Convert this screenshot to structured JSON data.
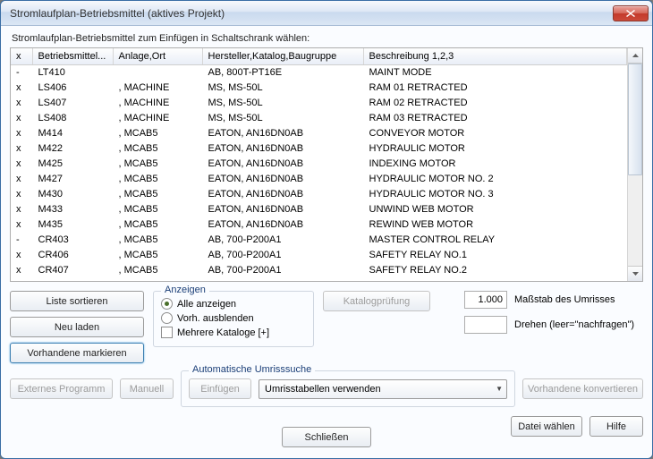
{
  "window": {
    "title": "Stromlaufplan-Betriebsmittel (aktives Projekt)"
  },
  "instruction": "Stromlaufplan-Betriebsmittel zum Einfügen in Schaltschrank wählen:",
  "table": {
    "headers": {
      "x": "x",
      "bm": "Betriebsmittel...",
      "ort": "Anlage,Ort",
      "hkb": "Hersteller,Katalog,Baugruppe",
      "besch": "Beschreibung 1,2,3"
    },
    "rows": [
      {
        "x": "-",
        "bm": "LT410",
        "ort": "",
        "hkb": "AB, 800T-PT16E",
        "besch": "MAINT MODE"
      },
      {
        "x": "x",
        "bm": "LS406",
        "ort": ", MACHINE",
        "hkb": "MS, MS-50L",
        "besch": "RAM 01 RETRACTED"
      },
      {
        "x": "x",
        "bm": "LS407",
        "ort": ", MACHINE",
        "hkb": "MS, MS-50L",
        "besch": "RAM 02 RETRACTED"
      },
      {
        "x": "x",
        "bm": "LS408",
        "ort": ", MACHINE",
        "hkb": "MS, MS-50L",
        "besch": "RAM 03 RETRACTED"
      },
      {
        "x": "x",
        "bm": "M414",
        "ort": ", MCAB5",
        "hkb": "EATON, AN16DN0AB",
        "besch": "CONVEYOR MOTOR"
      },
      {
        "x": "x",
        "bm": "M422",
        "ort": ", MCAB5",
        "hkb": "EATON, AN16DN0AB",
        "besch": "HYDRAULIC MOTOR"
      },
      {
        "x": "x",
        "bm": "M425",
        "ort": ", MCAB5",
        "hkb": "EATON, AN16DN0AB",
        "besch": "INDEXING MOTOR"
      },
      {
        "x": "x",
        "bm": "M427",
        "ort": ", MCAB5",
        "hkb": "EATON, AN16DN0AB",
        "besch": "HYDRAULIC MOTOR NO. 2"
      },
      {
        "x": "x",
        "bm": "M430",
        "ort": ", MCAB5",
        "hkb": "EATON, AN16DN0AB",
        "besch": "HYDRAULIC MOTOR NO. 3"
      },
      {
        "x": "x",
        "bm": "M433",
        "ort": ", MCAB5",
        "hkb": "EATON, AN16DN0AB",
        "besch": "UNWIND WEB MOTOR"
      },
      {
        "x": "x",
        "bm": "M435",
        "ort": ", MCAB5",
        "hkb": "EATON, AN16DN0AB",
        "besch": "REWIND WEB MOTOR"
      },
      {
        "x": "-",
        "bm": "CR403",
        "ort": ", MCAB5",
        "hkb": "AB, 700-P200A1",
        "besch": "MASTER CONTROL RELAY"
      },
      {
        "x": "x",
        "bm": "CR406",
        "ort": ", MCAB5",
        "hkb": "AB, 700-P200A1",
        "besch": "SAFETY RELAY NO.1"
      },
      {
        "x": "x",
        "bm": "CR407",
        "ort": ", MCAB5",
        "hkb": "AB, 700-P200A1",
        "besch": "SAFETY RELAY NO.2"
      }
    ]
  },
  "buttons": {
    "sort": "Liste sortieren",
    "reload": "Neu laden",
    "mark": "Vorhandene markieren",
    "ext": "Externes Programm",
    "manual": "Manuell",
    "insert": "Einfügen",
    "convert": "Vorhandene konvertieren",
    "close": "Schließen",
    "file": "Datei wählen",
    "help": "Hilfe",
    "catalog": "Katalogprüfung"
  },
  "radio": {
    "legend": "Anzeigen",
    "all": "Alle anzeigen",
    "hide": "Vorh. ausblenden",
    "multi": "Mehrere Kataloge [+]"
  },
  "scale": {
    "value": "1.000",
    "label": "Maßstab des Umrisses"
  },
  "rotate": {
    "label": "Drehen (leer=\"nachfragen\")"
  },
  "auto": {
    "legend": "Automatische Umrisssuche",
    "select": "Umrisstabellen verwenden"
  }
}
